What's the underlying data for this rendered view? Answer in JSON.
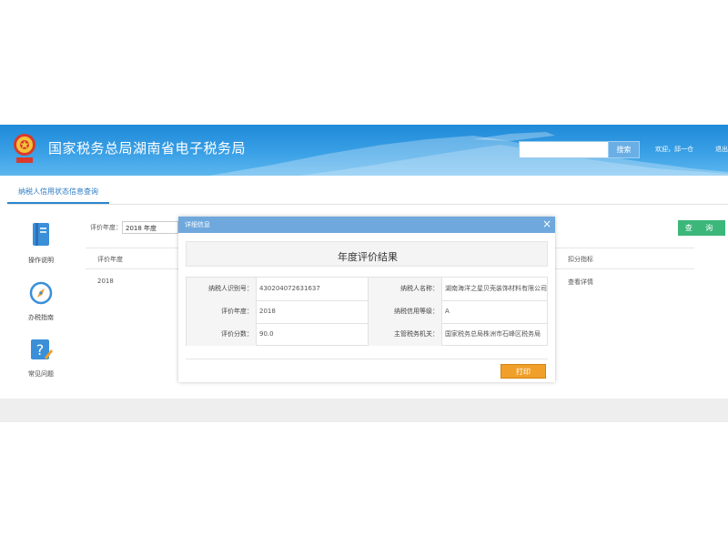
{
  "header": {
    "site_title": "国家税务总局湖南省电子税务局",
    "search_placeholder": "",
    "search_button": "搜索",
    "welcome": "欢迎，邱一仓",
    "logout": "退出"
  },
  "tabs": [
    {
      "label": "纳税人信用状态信息查询"
    }
  ],
  "sidebar": {
    "items": [
      {
        "label": "操作说明",
        "icon": "book-icon"
      },
      {
        "label": "办税指南",
        "icon": "compass-icon"
      },
      {
        "label": "常见问题",
        "icon": "question-icon"
      }
    ]
  },
  "filter": {
    "label": "评价年度：",
    "selected_year": "2018 年度",
    "query_button": "查 询"
  },
  "table": {
    "headers": {
      "year": "评价年度",
      "deduction": "扣分指标"
    },
    "rows": [
      {
        "year": "2018",
        "action": "查看详情"
      }
    ]
  },
  "modal": {
    "title": "详细信息",
    "close": "×",
    "result_title": "年度评价结果",
    "fields": {
      "taxpayer_id_label": "纳税人识别号：",
      "taxpayer_id": "430204072631637",
      "taxpayer_name_label": "纳税人名称：",
      "taxpayer_name": "湖南海洋之星贝壳装饰材料有限公司",
      "eval_year_label": "评价年度：",
      "eval_year": "2018",
      "credit_level_label": "纳税信用等级：",
      "credit_level": "A",
      "score_label": "评价分数：",
      "score": "90.0",
      "tax_authority_label": "主管税务机关：",
      "tax_authority": "国家税务总局株洲市石峰区税务局"
    },
    "print_button": "打印"
  },
  "colors": {
    "header_blue": "#2a8fdb",
    "tab_active": "#2a86d0",
    "query_green": "#3bb77a",
    "modal_header": "#6fa8dc",
    "print_orange": "#f0a02a"
  }
}
